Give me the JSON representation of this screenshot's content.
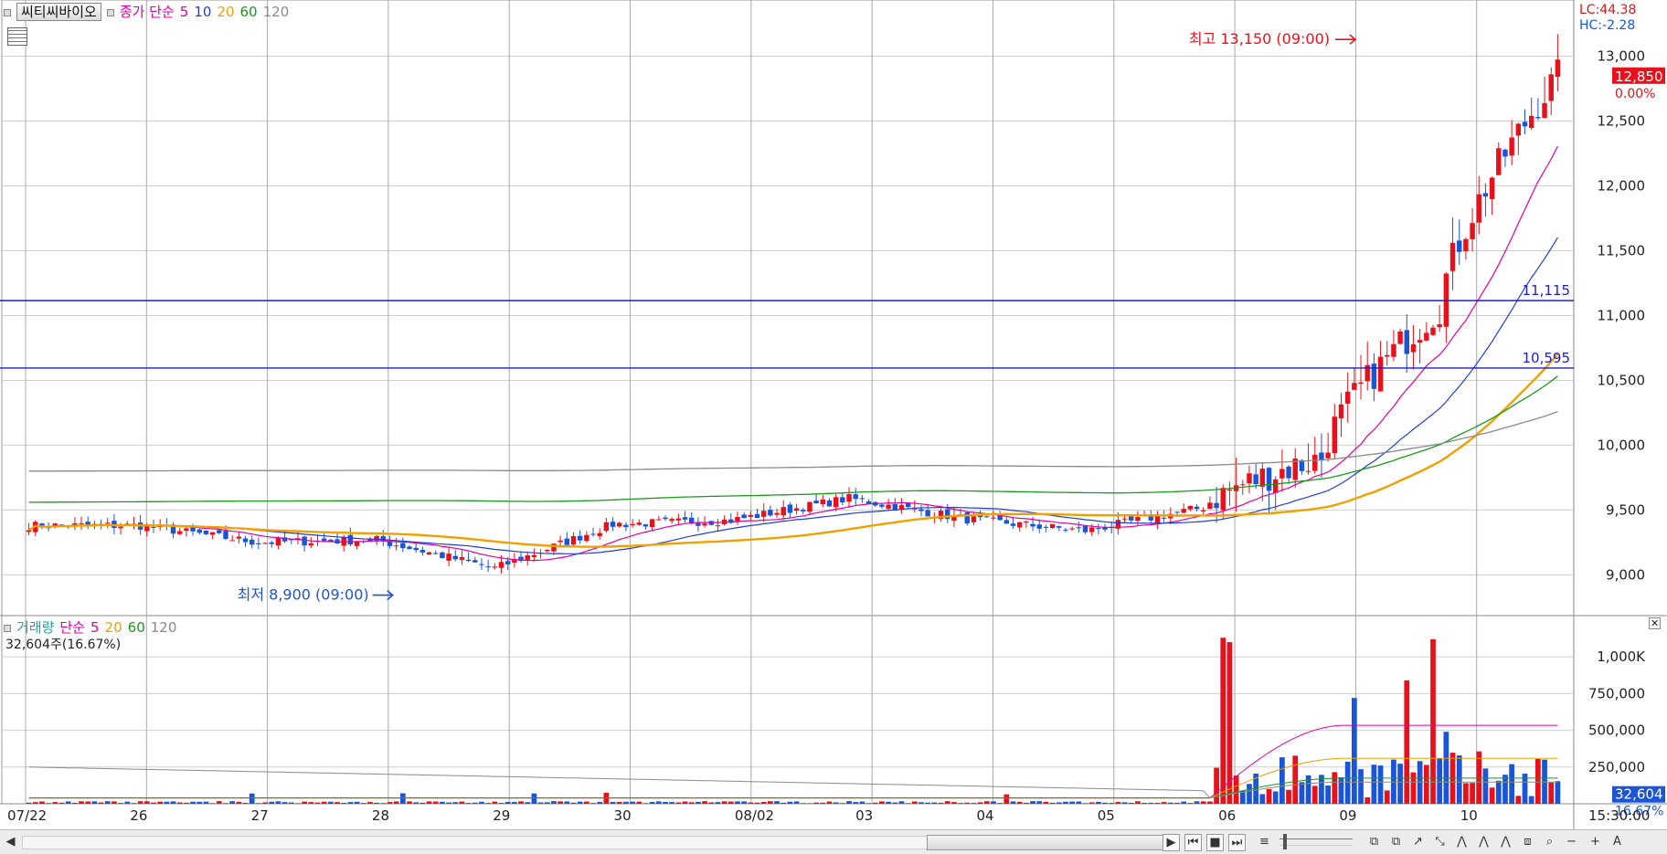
{
  "header": {
    "stock_name": "씨티씨바이오",
    "price_label": "종가 단순",
    "ma_periods": [
      "5",
      "10",
      "20",
      "60",
      "120"
    ],
    "ma_colors": [
      "#e000a0",
      "#1f3fd8",
      "#f0a000",
      "#1a9a1a",
      "#8a8a8a"
    ],
    "lc": "LC:44.38",
    "hc": "HC:-2.28"
  },
  "volume_header": {
    "label": "거래량",
    "ma_label": "단순",
    "ma_periods": [
      "5",
      "20",
      "60",
      "120"
    ],
    "current": "32,604주(16.67%)"
  },
  "colors": {
    "up": "#e8101a",
    "down": "#1a55d8",
    "ref_line": "#1c1cd0",
    "grid": "#cfcfcf"
  },
  "chart_data": [
    {
      "type": "candlestick",
      "x_labels": [
        "07/22",
        "26",
        "27",
        "28",
        "29",
        "30",
        "08/02",
        "03",
        "04",
        "05",
        "06",
        "09",
        "10"
      ],
      "ylim": [
        8700,
        13250
      ],
      "yticks": [
        9000,
        9500,
        10000,
        10500,
        11000,
        11500,
        12000,
        12500,
        13000
      ],
      "ytick_labels": [
        "9,000",
        "9,500",
        "10,000",
        "10,500",
        "11,000",
        "11,500",
        "12,000",
        "12,500",
        "13,000"
      ],
      "current_price": 12850,
      "current_price_label": "12,850",
      "current_change_label": "0.00%",
      "reference_lines": [
        {
          "value": 11115,
          "label": "11,115"
        },
        {
          "value": 10595,
          "label": "10,595"
        }
      ],
      "annotations": [
        {
          "text": "최고 13,150 (09:00)",
          "value": 13150,
          "color": "#e8101a"
        },
        {
          "text": "최저 8,900 (09:00)",
          "value": 8900,
          "color": "#1a55d8"
        }
      ],
      "daily_close": [
        9380,
        9250,
        9270,
        9050,
        9390,
        9420,
        9590,
        9430,
        9340,
        9520,
        9900,
        11060,
        12850
      ],
      "ma120_start": 9800,
      "ma60_start": 9560,
      "grid": true
    },
    {
      "type": "bar",
      "name": "거래량",
      "ylim": [
        0,
        1150000
      ],
      "yticks": [
        250000,
        500000,
        750000,
        1000000
      ],
      "ytick_labels": [
        "250,000",
        "500,000",
        "750,000",
        "1,000K"
      ],
      "current_value_label": "32,604",
      "current_ratio_label": "16.67%",
      "spikes": [
        {
          "value": 1130000,
          "color": "up"
        },
        {
          "value": 1100000,
          "color": "up"
        },
        {
          "value": 720000,
          "color": "down"
        },
        {
          "value": 840000,
          "color": "up"
        },
        {
          "value": 1120000,
          "color": "up"
        },
        {
          "value": 490000,
          "color": "down"
        }
      ]
    }
  ],
  "time_label": "15:30:00",
  "toolbar_glyphs": [
    "◀",
    "▶",
    "⏮",
    "■",
    "⏭",
    "≡",
    "⧉",
    "↗",
    "⤡",
    "⋀",
    "⋀",
    "⋀",
    "⧈",
    "⌕",
    "−",
    "+",
    "A"
  ]
}
